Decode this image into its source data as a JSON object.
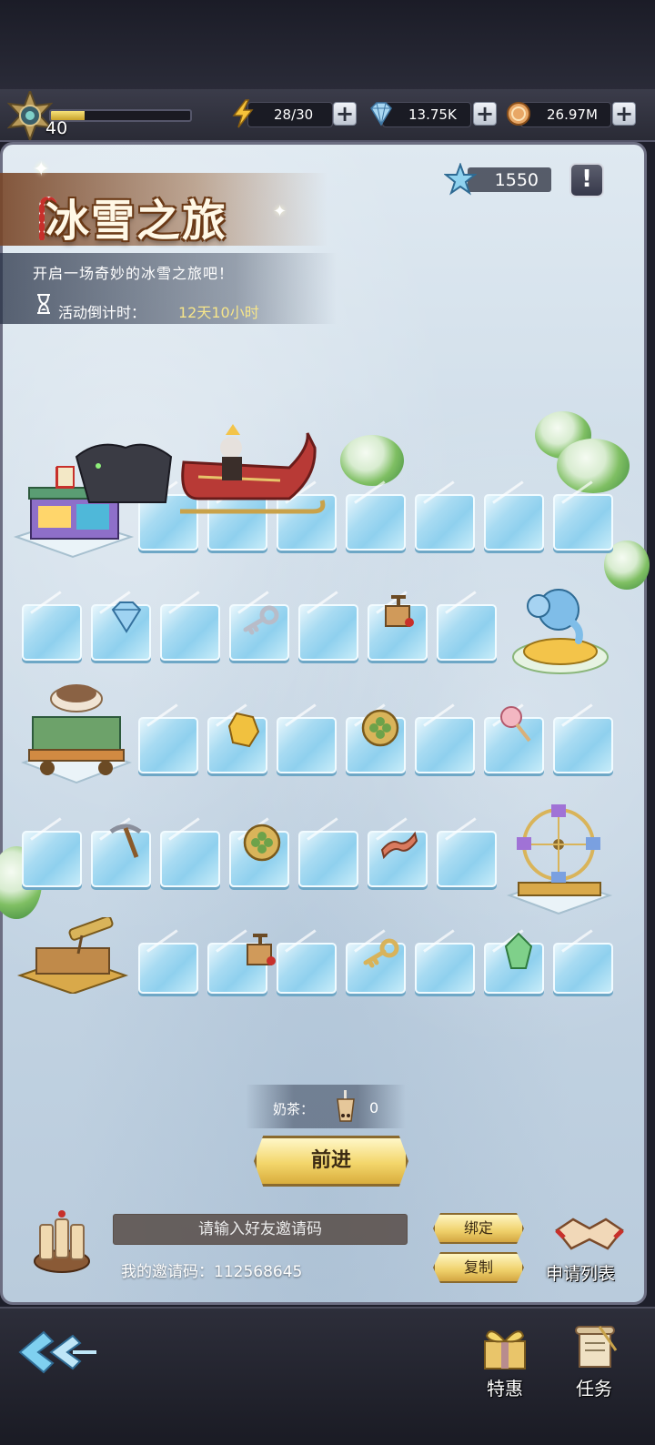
{
  "player": {
    "level": "40",
    "xp_fraction": 0.24
  },
  "resources": {
    "energy": "28/30",
    "diamonds": "13.75K",
    "coins": "26.97M"
  },
  "event": {
    "title": "冰雪之旅",
    "subtitle": "开启一场奇妙的冰雪之旅吧！",
    "countdown_label": "活动倒计时：",
    "countdown_value": "12天10小时",
    "stars": "1550",
    "info_label": "!"
  },
  "board": {
    "items": [
      "diamond-icon",
      "key-icon",
      "tnt-icon",
      "amber-gem-icon",
      "clover-coin-icon",
      "lollipop-icon",
      "pickaxe-icon",
      "bacon-icon",
      "green-gem-icon"
    ],
    "buildings": [
      "popcorn-stand",
      "elephant-ride",
      "tea-cart",
      "ferris-wheel",
      "telescope-deck"
    ]
  },
  "controls": {
    "milk_tea_label": "奶茶：",
    "milk_tea_count": "0",
    "advance_label": "前进",
    "invite_placeholder": "请输入好友邀请码",
    "my_invite_code": "我的邀请码：112568645",
    "bind_label": "绑定",
    "copy_label": "复制",
    "apply_list_label": "申请列表"
  },
  "nav": {
    "special_label": "特惠",
    "tasks_label": "任务"
  },
  "colors": {
    "accent_gold": "#f3d66b",
    "ice": "#a8dbf2",
    "countdown": "#f6e58a"
  }
}
